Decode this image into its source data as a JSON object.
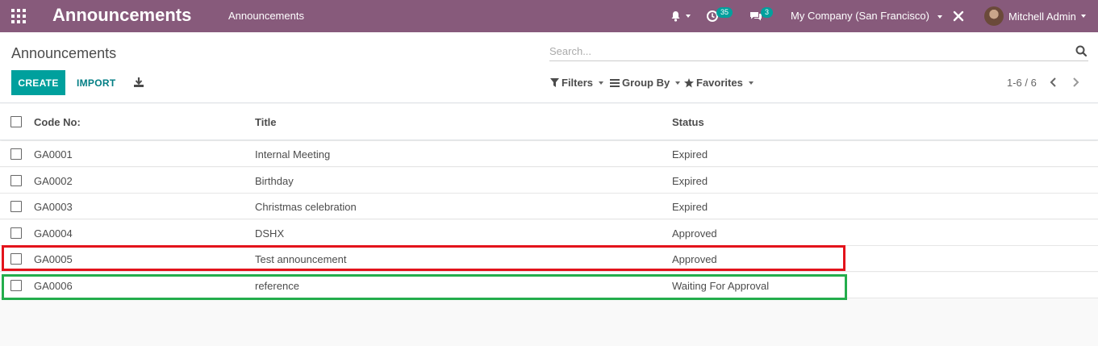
{
  "navbar": {
    "brand": "Announcements",
    "menu": [
      "Announcements"
    ],
    "activity_badge": "35",
    "message_badge": "3",
    "company": "My Company (San Francisco)",
    "user": "Mitchell Admin",
    "bg_color": "#875a7b"
  },
  "control_panel": {
    "breadcrumb": "Announcements",
    "search_placeholder": "Search...",
    "create_label": "CREATE",
    "import_label": "IMPORT",
    "filters_label": "Filters",
    "groupby_label": "Group By",
    "favorites_label": "Favorites",
    "pager": "1-6 / 6",
    "accent_color": "#00a09d"
  },
  "table": {
    "columns": [
      "Code No:",
      "Title",
      "Status"
    ],
    "rows": [
      {
        "code": "GA0001",
        "title": "Internal Meeting",
        "status": "Expired"
      },
      {
        "code": "GA0002",
        "title": "Birthday",
        "status": "Expired"
      },
      {
        "code": "GA0003",
        "title": "Christmas celebration",
        "status": "Expired"
      },
      {
        "code": "GA0004",
        "title": "DSHX",
        "status": "Approved"
      },
      {
        "code": "GA0005",
        "title": "Test announcement",
        "status": "Approved"
      },
      {
        "code": "GA0006",
        "title": "reference",
        "status": "Waiting For Approval"
      }
    ]
  },
  "highlights": {
    "red_color": "#e3131b",
    "green_color": "#23ad4c"
  }
}
